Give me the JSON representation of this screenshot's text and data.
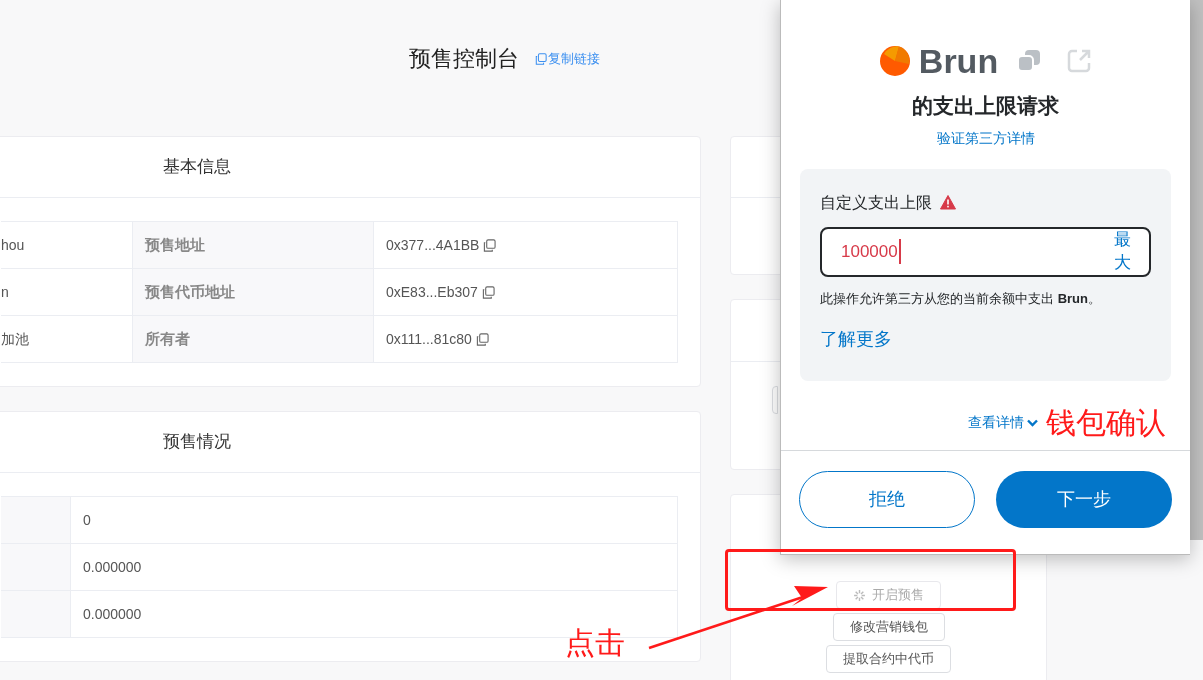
{
  "page_title": "预售控制台",
  "copy_link": "复制链接",
  "basic_info": {
    "title": "基本信息",
    "rows": [
      {
        "column_1": "hou",
        "label": "预售地址",
        "value": "0x377...4A1BB"
      },
      {
        "column_1": "n",
        "label": "预售代币地址",
        "value": "0xE83...Eb307"
      },
      {
        "column_1": "加池",
        "label": "所有者",
        "value": "0x111...81c80"
      }
    ]
  },
  "presale_status": {
    "title": "预售情况",
    "rows": [
      {
        "value": "0"
      },
      {
        "value": "0.000000"
      },
      {
        "value": "0.000000"
      }
    ]
  },
  "actions": [
    {
      "label": "开启预售",
      "loading": true
    },
    {
      "label": "修改营销钱包",
      "loading": false
    },
    {
      "label": "提取合约中代币",
      "loading": false
    }
  ],
  "wallet_popup": {
    "token": "Brun",
    "title": "的支出上限请求",
    "verify_link": "验证第三方详情",
    "limit_label": "自定义支出上限",
    "warning": true,
    "amount": "100000",
    "max_button": "最大",
    "note": "此操作允许第三方从您的当前余额中支出 **Brun**。",
    "learn_more": "了解更多",
    "details": "查看详情",
    "buttons": [
      {
        "label": "拒绝",
        "kind": "secondary"
      },
      {
        "label": "下一步",
        "kind": "primary"
      }
    ]
  },
  "annotations": [
    {
      "text": "钱包确认"
    },
    {
      "text": "点击"
    }
  ]
}
